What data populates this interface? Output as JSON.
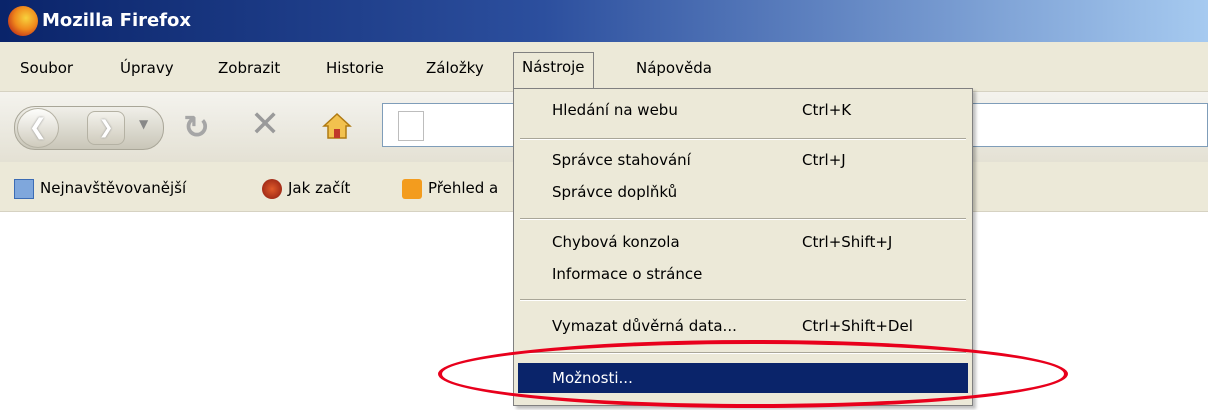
{
  "window": {
    "title": "Mozilla Firefox"
  },
  "menubar": {
    "items": [
      "Soubor",
      "Úpravy",
      "Zobrazit",
      "Historie",
      "Záložky",
      "Nástroje",
      "Nápověda"
    ]
  },
  "bookmarks": {
    "items": [
      "Nejnavštěvovanější",
      "Jak začít",
      "Přehled a"
    ]
  },
  "tools_menu": {
    "items": [
      {
        "label": "Hledání na webu",
        "shortcut": "Ctrl+K"
      },
      {
        "label": "Správce stahování",
        "shortcut": "Ctrl+J"
      },
      {
        "label": "Správce doplňků",
        "shortcut": ""
      },
      {
        "label": "Chybová konzola",
        "shortcut": "Ctrl+Shift+J"
      },
      {
        "label": "Informace o stránce",
        "shortcut": ""
      },
      {
        "label": "Vymazat důvěrná data...",
        "shortcut": "Ctrl+Shift+Del"
      },
      {
        "label": "Možnosti...",
        "shortcut": ""
      }
    ]
  },
  "icons": {
    "back": "back-arrow-icon",
    "forward": "forward-arrow-icon",
    "reload": "reload-icon",
    "stop": "stop-icon",
    "home": "home-icon"
  },
  "colors": {
    "highlight_ring": "#e8001c",
    "menu_selection": "#0a246a"
  }
}
